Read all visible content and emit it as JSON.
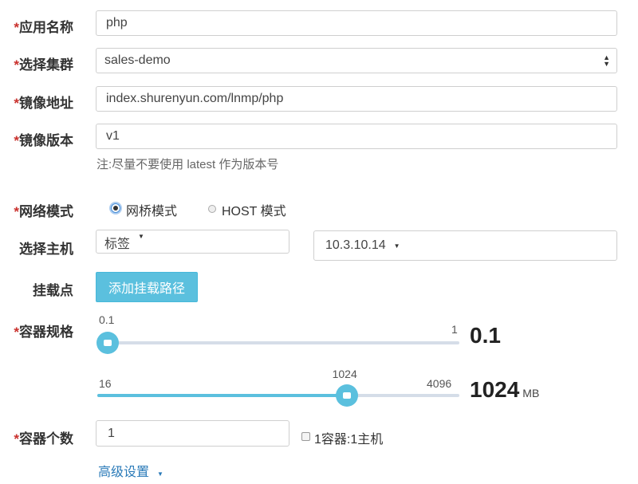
{
  "form": {
    "app_name": {
      "label": "应用名称",
      "value": "php"
    },
    "cluster": {
      "label": "选择集群",
      "value": "sales-demo"
    },
    "image_url": {
      "label": "镜像地址",
      "value": "index.shurenyun.com/lnmp/php"
    },
    "image_version": {
      "label": "镜像版本",
      "value": "v1",
      "hint": "注:尽量不要使用 latest 作为版本号"
    },
    "network": {
      "label": "网络模式",
      "options": [
        "网桥模式",
        "HOST 模式"
      ],
      "selected": "网桥模式"
    },
    "host": {
      "label": "选择主机",
      "tag_dropdown": "标签",
      "host_dropdown": "10.3.10.14"
    },
    "mount": {
      "label": "挂载点",
      "button": "添加挂载路径"
    },
    "spec": {
      "label": "容器规格",
      "cpu": {
        "min": "0.1",
        "max": "1",
        "value": "0.1",
        "fraction": 0.0
      },
      "mem": {
        "min": "16",
        "max": "4096",
        "value": "1024",
        "unit": "MB",
        "fraction": 0.7
      }
    },
    "count": {
      "label": "容器个数",
      "value": "1",
      "checkbox_label": "1容器:1主机"
    },
    "advanced": {
      "label": "高级设置"
    }
  },
  "required_mark": "*",
  "colors": {
    "accent": "#5bc0de",
    "required": "#c9302c",
    "link": "#2a7ab8"
  }
}
